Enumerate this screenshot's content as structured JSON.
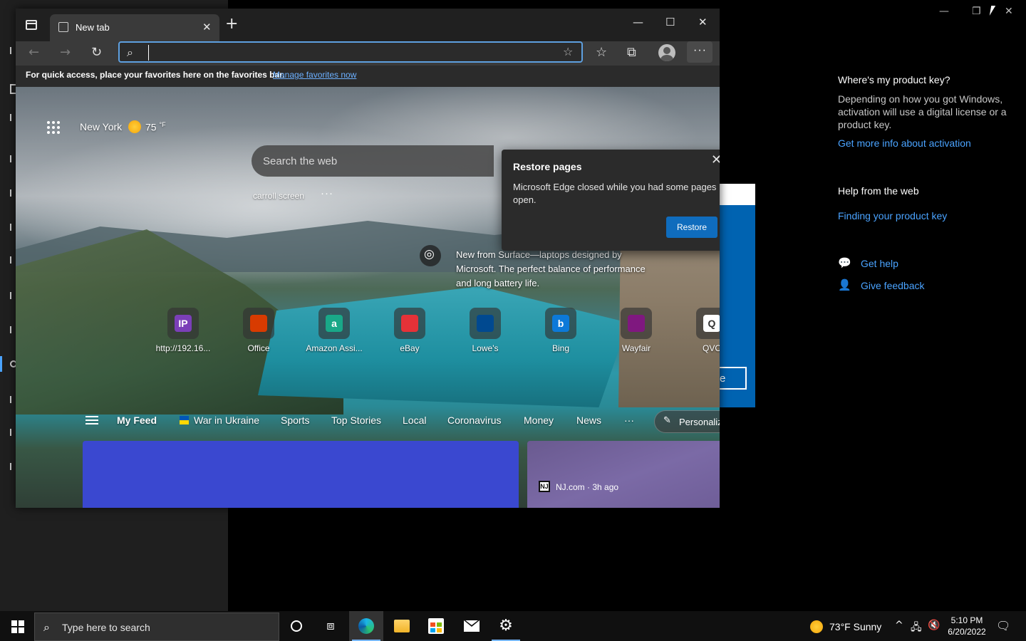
{
  "background_settings": {
    "side_sections": [
      {
        "title": "Where's my product key?",
        "text": "Depending on how you got Windows, activation will use a digital license or a product key.",
        "link": "Get more info about activation"
      },
      {
        "title": "Help from the web",
        "link": "Finding your product key"
      }
    ],
    "actions": {
      "get_help": "Get help",
      "give_feedback": "Give feedback"
    },
    "partial_button_text": "e",
    "window_controls": {
      "minimize": "—",
      "maximize": "❐",
      "close": "✕"
    }
  },
  "browser": {
    "tab_title": "New tab",
    "address_bar_value": "",
    "window_controls": {
      "minimize": "—",
      "maximize": "☐",
      "close": "✕"
    },
    "favorites_bar": {
      "text": "For quick access, place your favorites here on the favorites bar.",
      "link": "Manage favorites now"
    },
    "new_tab_page": {
      "weather_city": "New York",
      "weather_temp": "75",
      "weather_unit": "°F",
      "search_placeholder": "Search the web",
      "quick_link": "carroll screen",
      "promo_text": "New from Surface—laptops designed by Microsoft. The perfect balance of performance and long battery life.",
      "tiles": [
        {
          "label": "http://192.16...",
          "glyph": "IP",
          "color": "#7b3fb8"
        },
        {
          "label": "Office",
          "glyph": "",
          "color": "#d83b01"
        },
        {
          "label": "Amazon Assi...",
          "glyph": "a",
          "color": "#19a888"
        },
        {
          "label": "eBay",
          "glyph": "",
          "color": "#e53238"
        },
        {
          "label": "Lowe's",
          "glyph": "",
          "color": "#004990"
        },
        {
          "label": "Bing",
          "glyph": "b",
          "color": "#0c79d9"
        },
        {
          "label": "Wayfair",
          "glyph": "",
          "color": "#7f187f"
        },
        {
          "label": "QVC",
          "glyph": "Q",
          "color": "#ffffff"
        }
      ],
      "feed_tabs": [
        "My Feed",
        "War in Ukraine",
        "Sports",
        "Top Stories",
        "Local",
        "Coronavirus",
        "Money",
        "News"
      ],
      "feed_more": "···",
      "personalize": "Personalize",
      "card_source": "NJ.com · 3h ago",
      "card_source_icon": "NJ"
    },
    "restore_popup": {
      "title": "Restore pages",
      "body": "Microsoft Edge closed while you had some pages open.",
      "button": "Restore"
    }
  },
  "taskbar": {
    "search_placeholder": "Type here to search",
    "weather": "73°F  Sunny",
    "time": "5:10 PM",
    "date": "6/20/2022"
  }
}
